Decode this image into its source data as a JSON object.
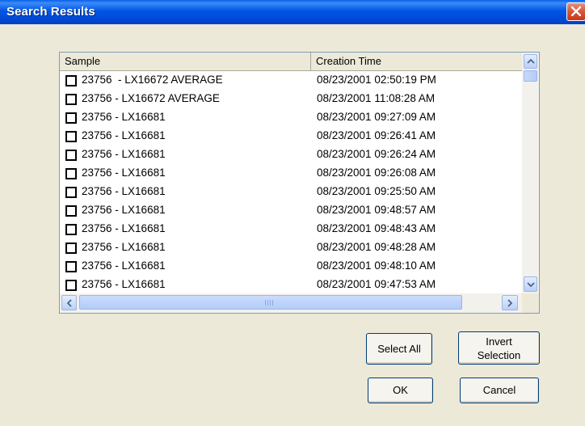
{
  "window": {
    "title": "Search Results"
  },
  "colors": {
    "titlebar": "#0055E5",
    "close_button": "#D8593A",
    "dialog_bg": "#ECE9D8"
  },
  "columns": {
    "sample": "Sample",
    "creation_time": "Creation Time"
  },
  "rows": [
    {
      "sample": "23756  - LX16672 AVERAGE",
      "creation_time": "08/23/2001 02:50:19 PM",
      "checked": false
    },
    {
      "sample": "23756 - LX16672 AVERAGE",
      "creation_time": "08/23/2001 11:08:28 AM",
      "checked": false
    },
    {
      "sample": "23756 - LX16681",
      "creation_time": "08/23/2001 09:27:09 AM",
      "checked": false
    },
    {
      "sample": "23756 - LX16681",
      "creation_time": "08/23/2001 09:26:41 AM",
      "checked": false
    },
    {
      "sample": "23756 - LX16681",
      "creation_time": "08/23/2001 09:26:24 AM",
      "checked": false
    },
    {
      "sample": "23756 - LX16681",
      "creation_time": "08/23/2001 09:26:08 AM",
      "checked": false
    },
    {
      "sample": "23756 - LX16681",
      "creation_time": "08/23/2001 09:25:50 AM",
      "checked": false
    },
    {
      "sample": "23756 - LX16681",
      "creation_time": "08/23/2001 09:48:57 AM",
      "checked": false
    },
    {
      "sample": "23756 - LX16681",
      "creation_time": "08/23/2001 09:48:43 AM",
      "checked": false
    },
    {
      "sample": "23756 - LX16681",
      "creation_time": "08/23/2001 09:48:28 AM",
      "checked": false
    },
    {
      "sample": "23756 - LX16681",
      "creation_time": "08/23/2001 09:48:10 AM",
      "checked": false
    },
    {
      "sample": "23756 - LX16681",
      "creation_time": "08/23/2001 09:47:53 AM",
      "checked": false
    }
  ],
  "buttons": {
    "select_all": "Select All",
    "invert_selection_line1": "Invert",
    "invert_selection_line2": "Selection",
    "ok": "OK",
    "cancel": "Cancel"
  },
  "icons": {
    "close": "close-x-icon",
    "scroll_up": "up-arrow-icon",
    "scroll_down": "down-arrow-icon",
    "scroll_left": "left-arrow-icon",
    "scroll_right": "right-arrow-icon"
  }
}
